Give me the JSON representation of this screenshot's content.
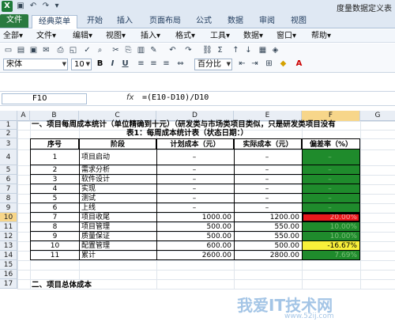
{
  "titlebar": {
    "title": "度量数据定义表"
  },
  "tabs": [
    {
      "label": "文件"
    },
    {
      "label": "经典菜单"
    },
    {
      "label": "开始"
    },
    {
      "label": "插入"
    },
    {
      "label": "页面布局"
    },
    {
      "label": "公式"
    },
    {
      "label": "数据"
    },
    {
      "label": "审阅"
    },
    {
      "label": "视图"
    }
  ],
  "menus": [
    "全部▾",
    "文件▾",
    "编辑▾",
    "视图▾",
    "插入▾",
    "格式▾",
    "工具▾",
    "数据▾",
    "窗口▾",
    "帮助▾"
  ],
  "toolbar": {
    "font_name": "宋体",
    "font_size": "10",
    "number_format": "百分比"
  },
  "formula_bar": {
    "cell_ref": "F10",
    "fx": "fx",
    "formula": "=(E10-D10)/D10"
  },
  "columns": [
    "A",
    "B",
    "C",
    "D",
    "E",
    "F",
    "G"
  ],
  "rows": [
    "1",
    "2",
    "3",
    "4",
    "5",
    "6",
    "7",
    "8",
    "9",
    "10",
    "11",
    "12",
    "13",
    "14",
    "15",
    "16",
    "17"
  ],
  "sheet": {
    "row1": "一、项目每周成本统计（单位精确到十元）（研发类与市场类项目类似，只是研发类项目没有",
    "row2": "表1：每周成本统计表（状态日期：）",
    "headers": [
      "序号",
      "阶段",
      "计划成本（元）",
      "实际成本（元）",
      "偏差率（%）"
    ],
    "data": [
      {
        "no": "1",
        "stage": "项目启动",
        "plan": "–",
        "actual": "–",
        "dev": "–"
      },
      {
        "no": "2",
        "stage": "需求分析",
        "plan": "–",
        "actual": "–",
        "dev": "–"
      },
      {
        "no": "3",
        "stage": "软件设计",
        "plan": "–",
        "actual": "–",
        "dev": "–"
      },
      {
        "no": "4",
        "stage": "实现",
        "plan": "–",
        "actual": "–",
        "dev": "–"
      },
      {
        "no": "5",
        "stage": "测试",
        "plan": "–",
        "actual": "–",
        "dev": "–"
      },
      {
        "no": "6",
        "stage": "上线",
        "plan": "–",
        "actual": "–",
        "dev": "–"
      },
      {
        "no": "7",
        "stage": "项目收尾",
        "plan": "1000.00",
        "actual": "1200.00",
        "dev": "20.00%"
      },
      {
        "no": "8",
        "stage": "项目管理",
        "plan": "500.00",
        "actual": "550.00",
        "dev": "10.00%"
      },
      {
        "no": "9",
        "stage": "质量保证",
        "plan": "500.00",
        "actual": "550.00",
        "dev": "10.00%"
      },
      {
        "no": "10",
        "stage": "配置管理",
        "plan": "600.00",
        "actual": "500.00",
        "dev": "-16.67%"
      },
      {
        "no": "11",
        "stage": "累计",
        "plan": "2600.00",
        "actual": "2800.00",
        "dev": "7.69%"
      }
    ],
    "row17": "二、项目总体成本"
  },
  "watermark": {
    "text": "我爱IT技术网",
    "sub": "www.52ij.com"
  },
  "colors": {
    "green": "#1f8b2c",
    "red": "#e8191c",
    "yellow": "#f8f03a",
    "selection": "#f7d68a",
    "file_tab": "#2a7a3f"
  }
}
